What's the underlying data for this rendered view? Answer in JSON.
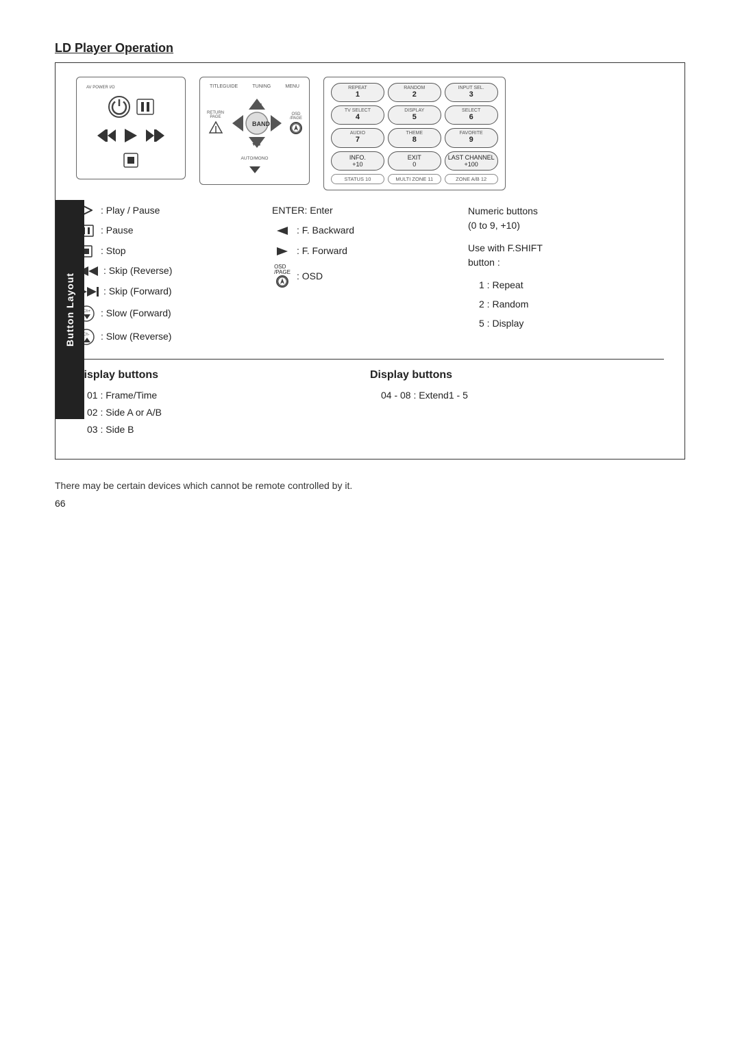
{
  "page": {
    "title": "LD Player Operation",
    "section_tab": "Button Layout",
    "footnote": "There may be certain devices which cannot be remote controlled by it.",
    "page_number": "66"
  },
  "remote_left": {
    "power_label": "AV POWER I/O",
    "tuning_label": "TUNING",
    "title_label": "TITLEGUIDE",
    "menu_label": "MENU"
  },
  "remote_right": {
    "buttons": [
      {
        "top": "REPEAT",
        "num": "1",
        "bot": ""
      },
      {
        "top": "RANDOM",
        "num": "2",
        "bot": ""
      },
      {
        "top": "INPUT SEL.",
        "num": "3",
        "bot": ""
      },
      {
        "top": "TV SELECT",
        "num": "4",
        "bot": ""
      },
      {
        "top": "DISPLAY",
        "num": "5",
        "bot": ""
      },
      {
        "top": "SELECT",
        "num": "6",
        "bot": ""
      },
      {
        "top": "AUDIO",
        "num": "7",
        "bot": ""
      },
      {
        "top": "THEME",
        "num": "8",
        "bot": ""
      },
      {
        "top": "FAVORITE",
        "num": "9",
        "bot": ""
      },
      {
        "top": "INFO.",
        "num": "+10",
        "bot": ""
      },
      {
        "top": "EXIT",
        "num": "0",
        "bot": ""
      },
      {
        "top": "LAST CHANNEL",
        "num": "+100",
        "bot": ""
      }
    ],
    "status_buttons": [
      {
        "label": "STATUS\n10"
      },
      {
        "label": "MULTI ZONE\n11"
      },
      {
        "label": "ZONE A/B\n12"
      }
    ]
  },
  "legend": {
    "col1": [
      {
        "icon": "play",
        "text": ": Play / Pause"
      },
      {
        "icon": "pause",
        "text": ": Pause"
      },
      {
        "icon": "stop",
        "text": ": Stop"
      },
      {
        "icon": "skip-rev",
        "text": ": Skip (Reverse)"
      },
      {
        "icon": "skip-fwd",
        "text": ": Skip (Forward)"
      },
      {
        "icon": "slow-fwd",
        "text": ": Slow (Forward)"
      },
      {
        "icon": "slow-rev",
        "text": ": Slow (Reverse)"
      }
    ],
    "col2": [
      {
        "icon": "enter",
        "text": "ENTER: Enter"
      },
      {
        "icon": "f-back",
        "text": ": F. Backward"
      },
      {
        "icon": "f-fwd",
        "text": ": F. Forward"
      },
      {
        "icon": "osd",
        "text": ": OSD"
      }
    ],
    "col3_title": "Numeric buttons\n(0 to 9, +10)",
    "col3_subtitle": "Use with F.SHIFT\nbutton :",
    "col3_items": [
      "1 : Repeat",
      "2 : Random",
      "5 : Display"
    ]
  },
  "display_buttons": {
    "left": {
      "title": "Display buttons",
      "items": [
        "01 : Frame/Time",
        "02 : Side A or A/B",
        "03 : Side B"
      ]
    },
    "right": {
      "title": "Display buttons",
      "items": [
        "04 - 08 : Extend1 - 5"
      ]
    }
  }
}
